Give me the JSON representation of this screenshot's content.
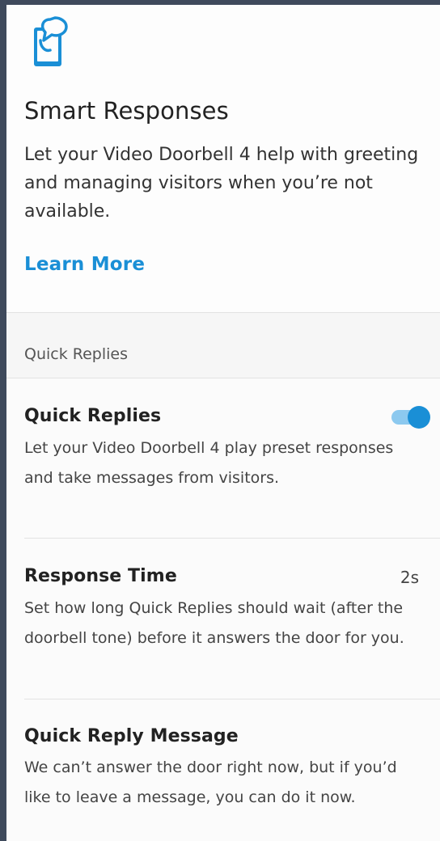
{
  "header": {
    "title": "Smart Responses",
    "description": "Let your Video Doorbell 4 help with greeting and managing visitors when you’re not available.",
    "learn_more": "Learn More",
    "icon": "smart-responses-icon",
    "accent_color": "#1a8fd6"
  },
  "section": {
    "label": "Quick Replies"
  },
  "settings": {
    "quick_replies": {
      "title": "Quick Replies",
      "description": "Let your Video Doorbell 4 play preset responses and take messages from visitors.",
      "enabled": true
    },
    "response_time": {
      "title": "Response Time",
      "value": "2s",
      "description": "Set how long Quick Replies should wait (after the doorbell tone) before it answers the door for you."
    },
    "quick_reply_message": {
      "title": "Quick Reply Message",
      "description": "We can’t answer the door right now, but if you’d like to leave a message, you can do it now."
    }
  }
}
